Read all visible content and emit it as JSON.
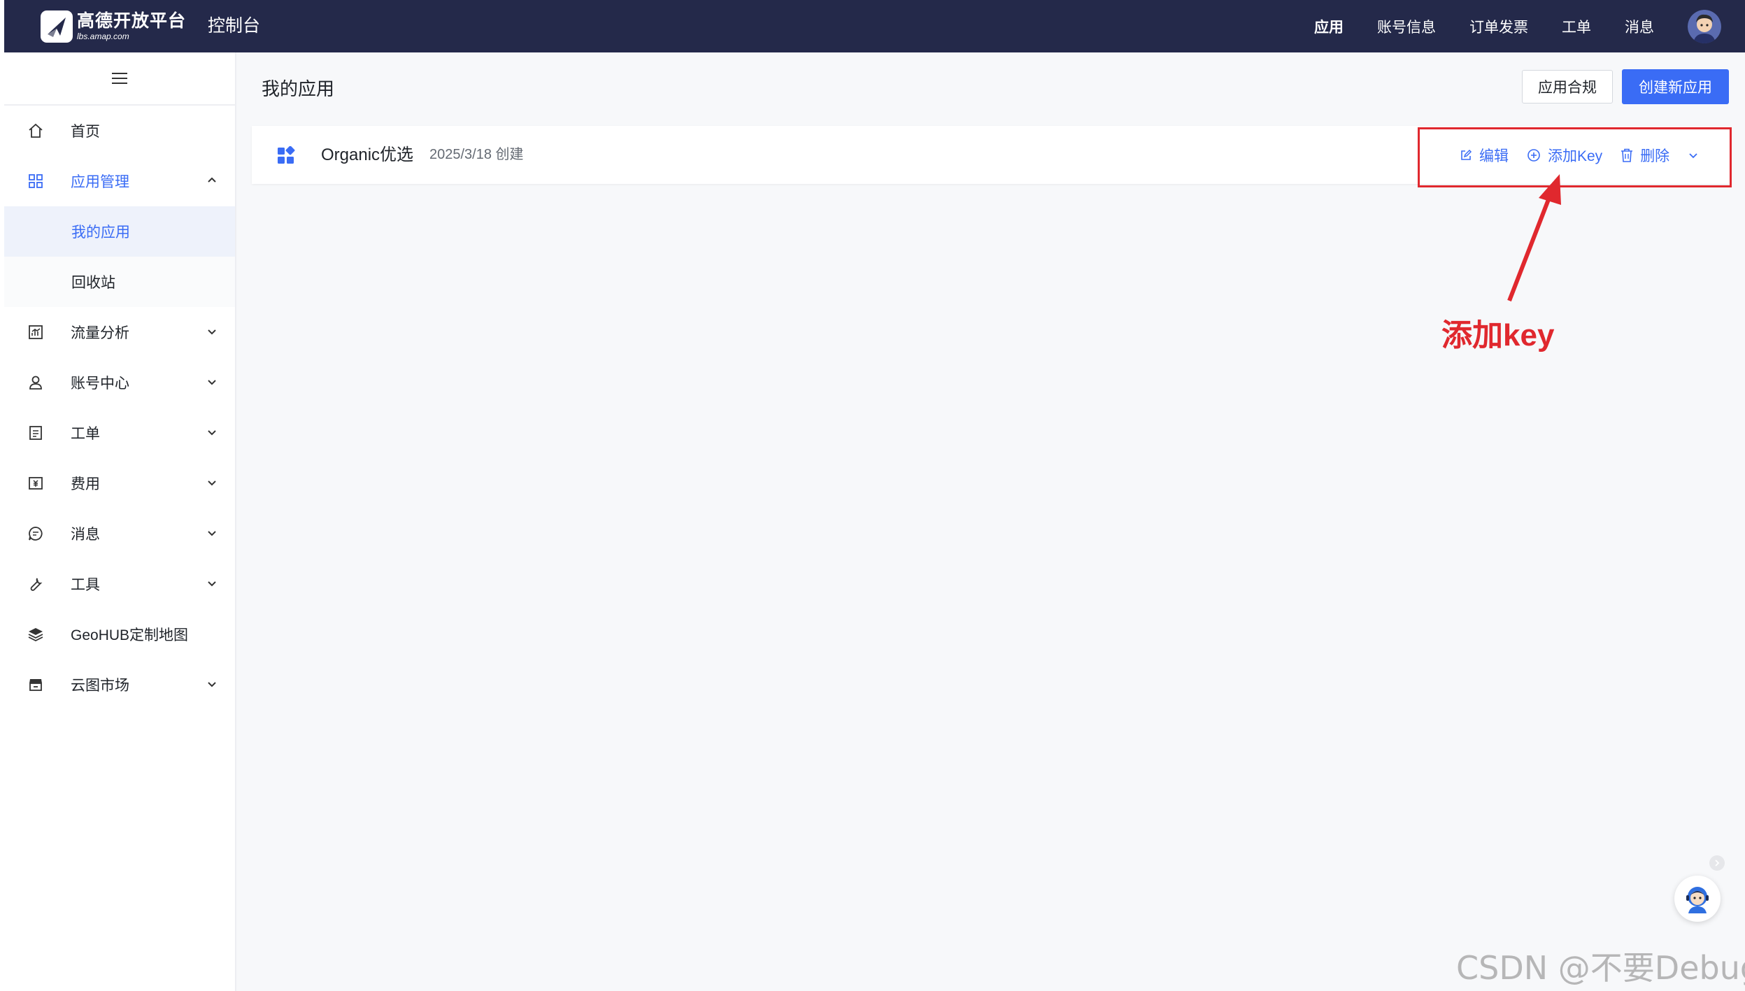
{
  "header": {
    "logo_name": "高德开放平台",
    "logo_url": "lbs.amap.com",
    "console_title": "控制台",
    "nav": [
      "应用",
      "账号信息",
      "订单发票",
      "工单",
      "消息"
    ]
  },
  "sidebar": {
    "items": [
      {
        "label": "首页",
        "icon": "home-icon"
      },
      {
        "label": "应用管理",
        "icon": "grid-icon",
        "expanded": true
      },
      {
        "label": "我的应用"
      },
      {
        "label": "回收站"
      },
      {
        "label": "流量分析",
        "icon": "chart-icon"
      },
      {
        "label": "账号中心",
        "icon": "user-icon"
      },
      {
        "label": "工单",
        "icon": "ticket-icon"
      },
      {
        "label": "费用",
        "icon": "billing-icon"
      },
      {
        "label": "消息",
        "icon": "message-icon"
      },
      {
        "label": "工具",
        "icon": "wrench-icon"
      },
      {
        "label": "GeoHUB定制地图",
        "icon": "layers-icon"
      },
      {
        "label": "云图市场",
        "icon": "store-icon"
      }
    ]
  },
  "main": {
    "page_title": "我的应用",
    "compliance_button": "应用合规",
    "create_button": "创建新应用",
    "apps": [
      {
        "name": "Organic优选",
        "created": "2025/3/18 创建",
        "actions": {
          "edit": "编辑",
          "add_key": "添加Key",
          "delete": "删除"
        }
      }
    ]
  },
  "annotation": {
    "text": "添加key",
    "color": "#e0282e"
  },
  "watermark": "CSDN @不要Debug",
  "colors": {
    "topbar": "#24294a",
    "accent": "#3a6cf5",
    "annotation": "#e0282e"
  }
}
